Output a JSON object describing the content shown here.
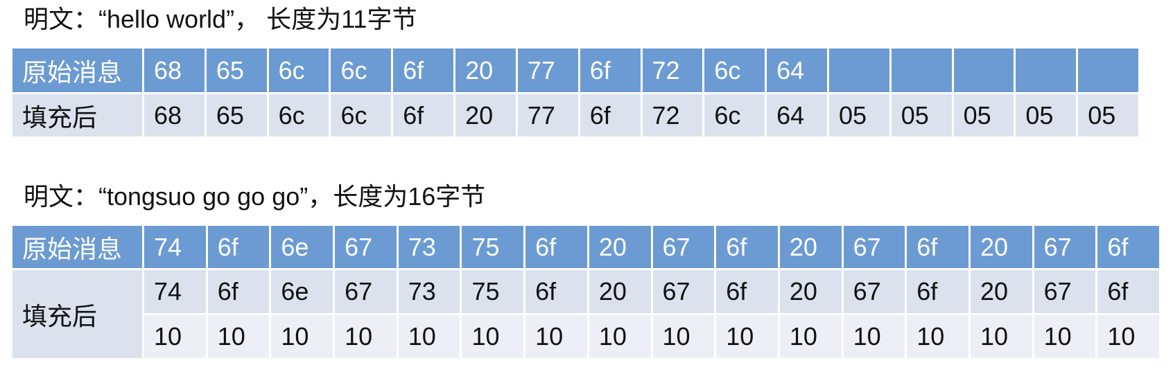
{
  "example1": {
    "caption": "明文：“hello world”， 长度为11字节",
    "row_original_label": "原始消息",
    "row_padded_label": "填充后",
    "original": [
      "68",
      "65",
      "6c",
      "6c",
      "6f",
      "20",
      "77",
      "6f",
      "72",
      "6c",
      "64",
      "",
      "",
      "",
      "",
      ""
    ],
    "padded": [
      "68",
      "65",
      "6c",
      "6c",
      "6f",
      "20",
      "77",
      "6f",
      "72",
      "6c",
      "64",
      "05",
      "05",
      "05",
      "05",
      "05"
    ]
  },
  "example2": {
    "caption": "明文：“tongsuo go go go”，长度为16字节",
    "row_original_label": "原始消息",
    "row_padded_label": "填充后",
    "original": [
      "74",
      "6f",
      "6e",
      "67",
      "73",
      "75",
      "6f",
      "20",
      "67",
      "6f",
      "20",
      "67",
      "6f",
      "20",
      "67",
      "6f"
    ],
    "padded": [
      "74",
      "6f",
      "6e",
      "67",
      "73",
      "75",
      "6f",
      "20",
      "67",
      "6f",
      "20",
      "67",
      "6f",
      "20",
      "67",
      "6f"
    ],
    "padding": [
      "10",
      "10",
      "10",
      "10",
      "10",
      "10",
      "10",
      "10",
      "10",
      "10",
      "10",
      "10",
      "10",
      "10",
      "10",
      "10"
    ]
  },
  "colors": {
    "header_row": "#6b9bd2",
    "body_row": "#dbe2ee",
    "body_row_light": "#eceff5"
  }
}
